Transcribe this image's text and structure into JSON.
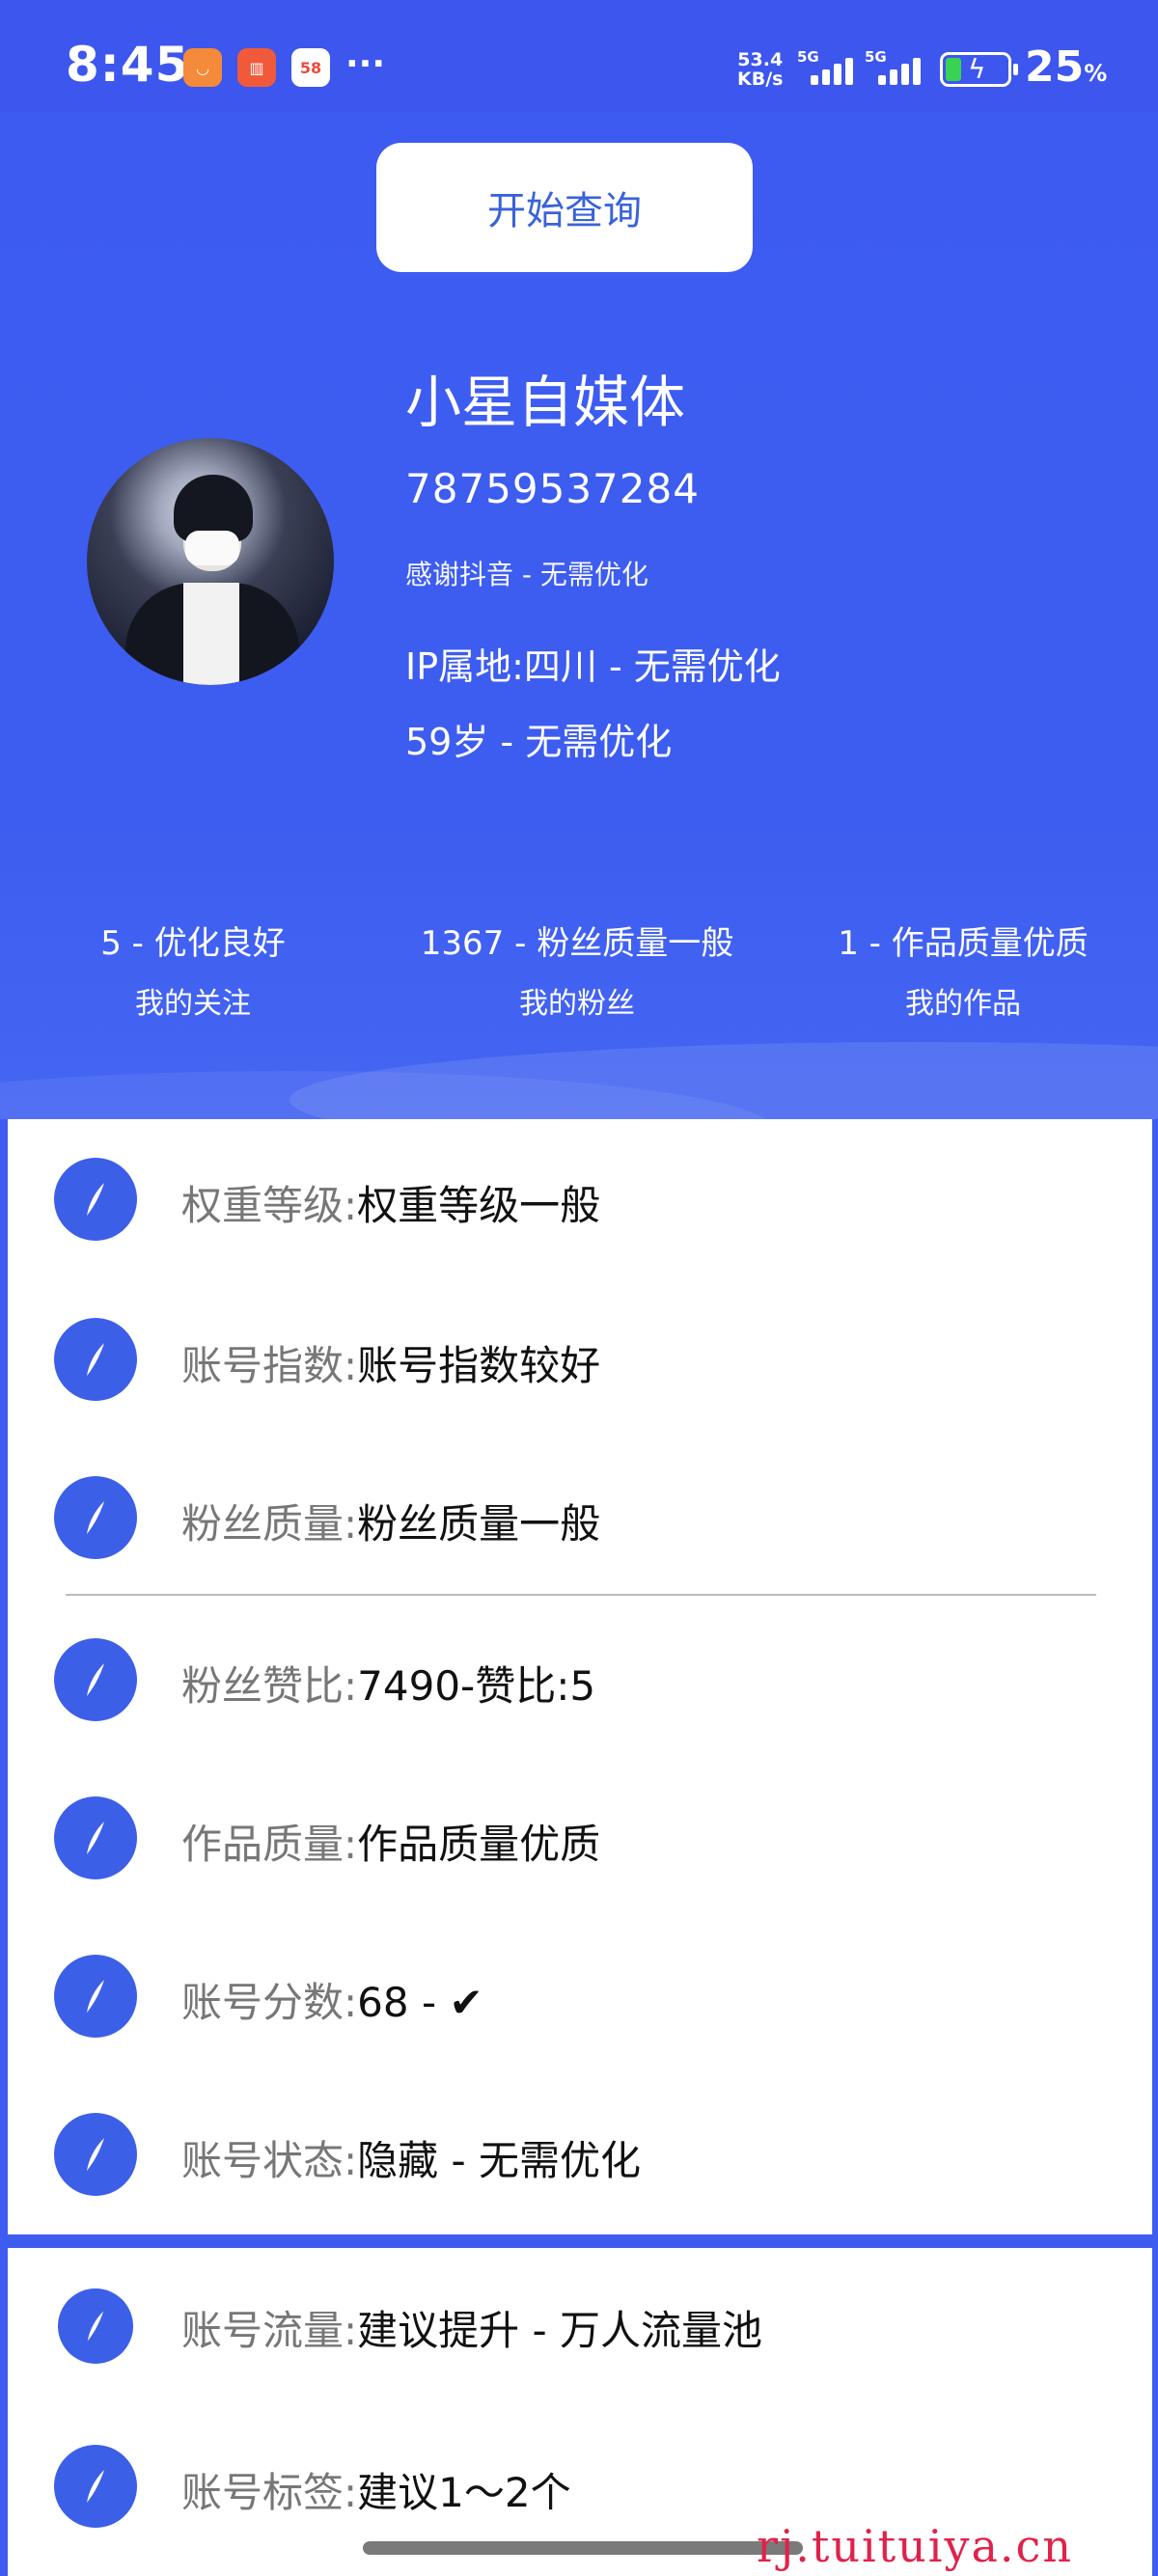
{
  "status_bar": {
    "time": "8:45",
    "app_icons": [
      "shopping-app-icon",
      "delete-app-icon",
      "58-app-icon"
    ],
    "app3_label": "58",
    "more": "···",
    "net_speed_top": "53.4",
    "net_speed_bottom": "KB/s",
    "sim1": "5G",
    "sim2": "5G",
    "battery_percent": "25",
    "battery_unit": "%"
  },
  "header": {
    "query_button": "开始查询",
    "name": "小星自媒体",
    "account_id": "78759537284",
    "note": "感谢抖音 - 无需优化",
    "ip": "IP属地:四川 - 无需优化",
    "age": "59岁 - 无需优化"
  },
  "stats": [
    {
      "value": "5 - 优化良好",
      "label": "我的关注"
    },
    {
      "value": "1367 - 粉丝质量一般",
      "label": "我的粉丝"
    },
    {
      "value": "1 - 作品质量优质",
      "label": "我的作品"
    }
  ],
  "metrics": [
    {
      "key": "权重等级:",
      "value": "权重等级一般"
    },
    {
      "key": "账号指数:",
      "value": "账号指数较好"
    },
    {
      "key": "粉丝质量:",
      "value": "粉丝质量一般"
    },
    {
      "key": "粉丝赞比:",
      "value": "7490-赞比:5"
    },
    {
      "key": "作品质量:",
      "value": "作品质量优质"
    },
    {
      "key": "账号分数:",
      "value": "68 - ✔"
    },
    {
      "key": "账号状态:",
      "value": "隐藏 - 无需优化"
    }
  ],
  "metrics2": [
    {
      "key": "账号流量:",
      "value": "建议提升 - 万人流量池"
    },
    {
      "key": "账号标签:",
      "value": "建议1～2个"
    }
  ],
  "watermark": "rj.tuituiya.cn",
  "colors": {
    "primary": "#3d5bf1",
    "icon_bg": "#3c5fe8",
    "watermark": "#e0224a"
  }
}
